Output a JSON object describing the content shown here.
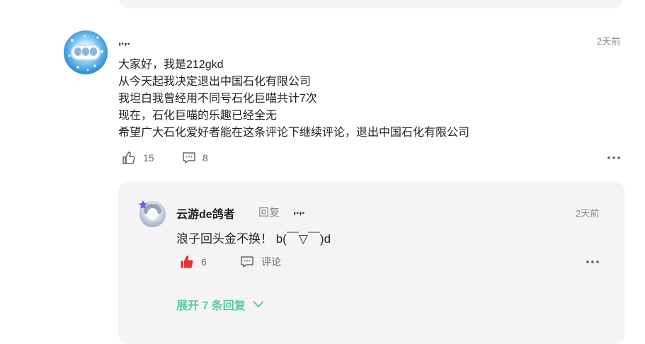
{
  "comment": {
    "username": ",.,.",
    "time": "2天前",
    "lines": [
      "大家好，我是212gkd",
      "从今天起我决定退出中国石化有限公司",
      "我坦白我曾经用不同号石化巨喵共计7次",
      "现在，石化巨喵的乐趣已经全无",
      "希望广大石化爱好者能在这条评论下继续评论，退出中国石化有限公司"
    ],
    "like_count": "15",
    "reply_count": "8"
  },
  "reply": {
    "username": "云游de鸽者",
    "reply_label": "回复",
    "reply_to": ",.,.",
    "time": "2天前",
    "text": "浪子回头金不换！ b(￣▽￣)d",
    "like_count": "6",
    "comment_label": "评论",
    "expand_label": "展开 7 条回复",
    "like_color": "#e8312f"
  },
  "colors": {
    "accent_green": "#5ccaa4",
    "card_bg": "#f4f4f5"
  }
}
